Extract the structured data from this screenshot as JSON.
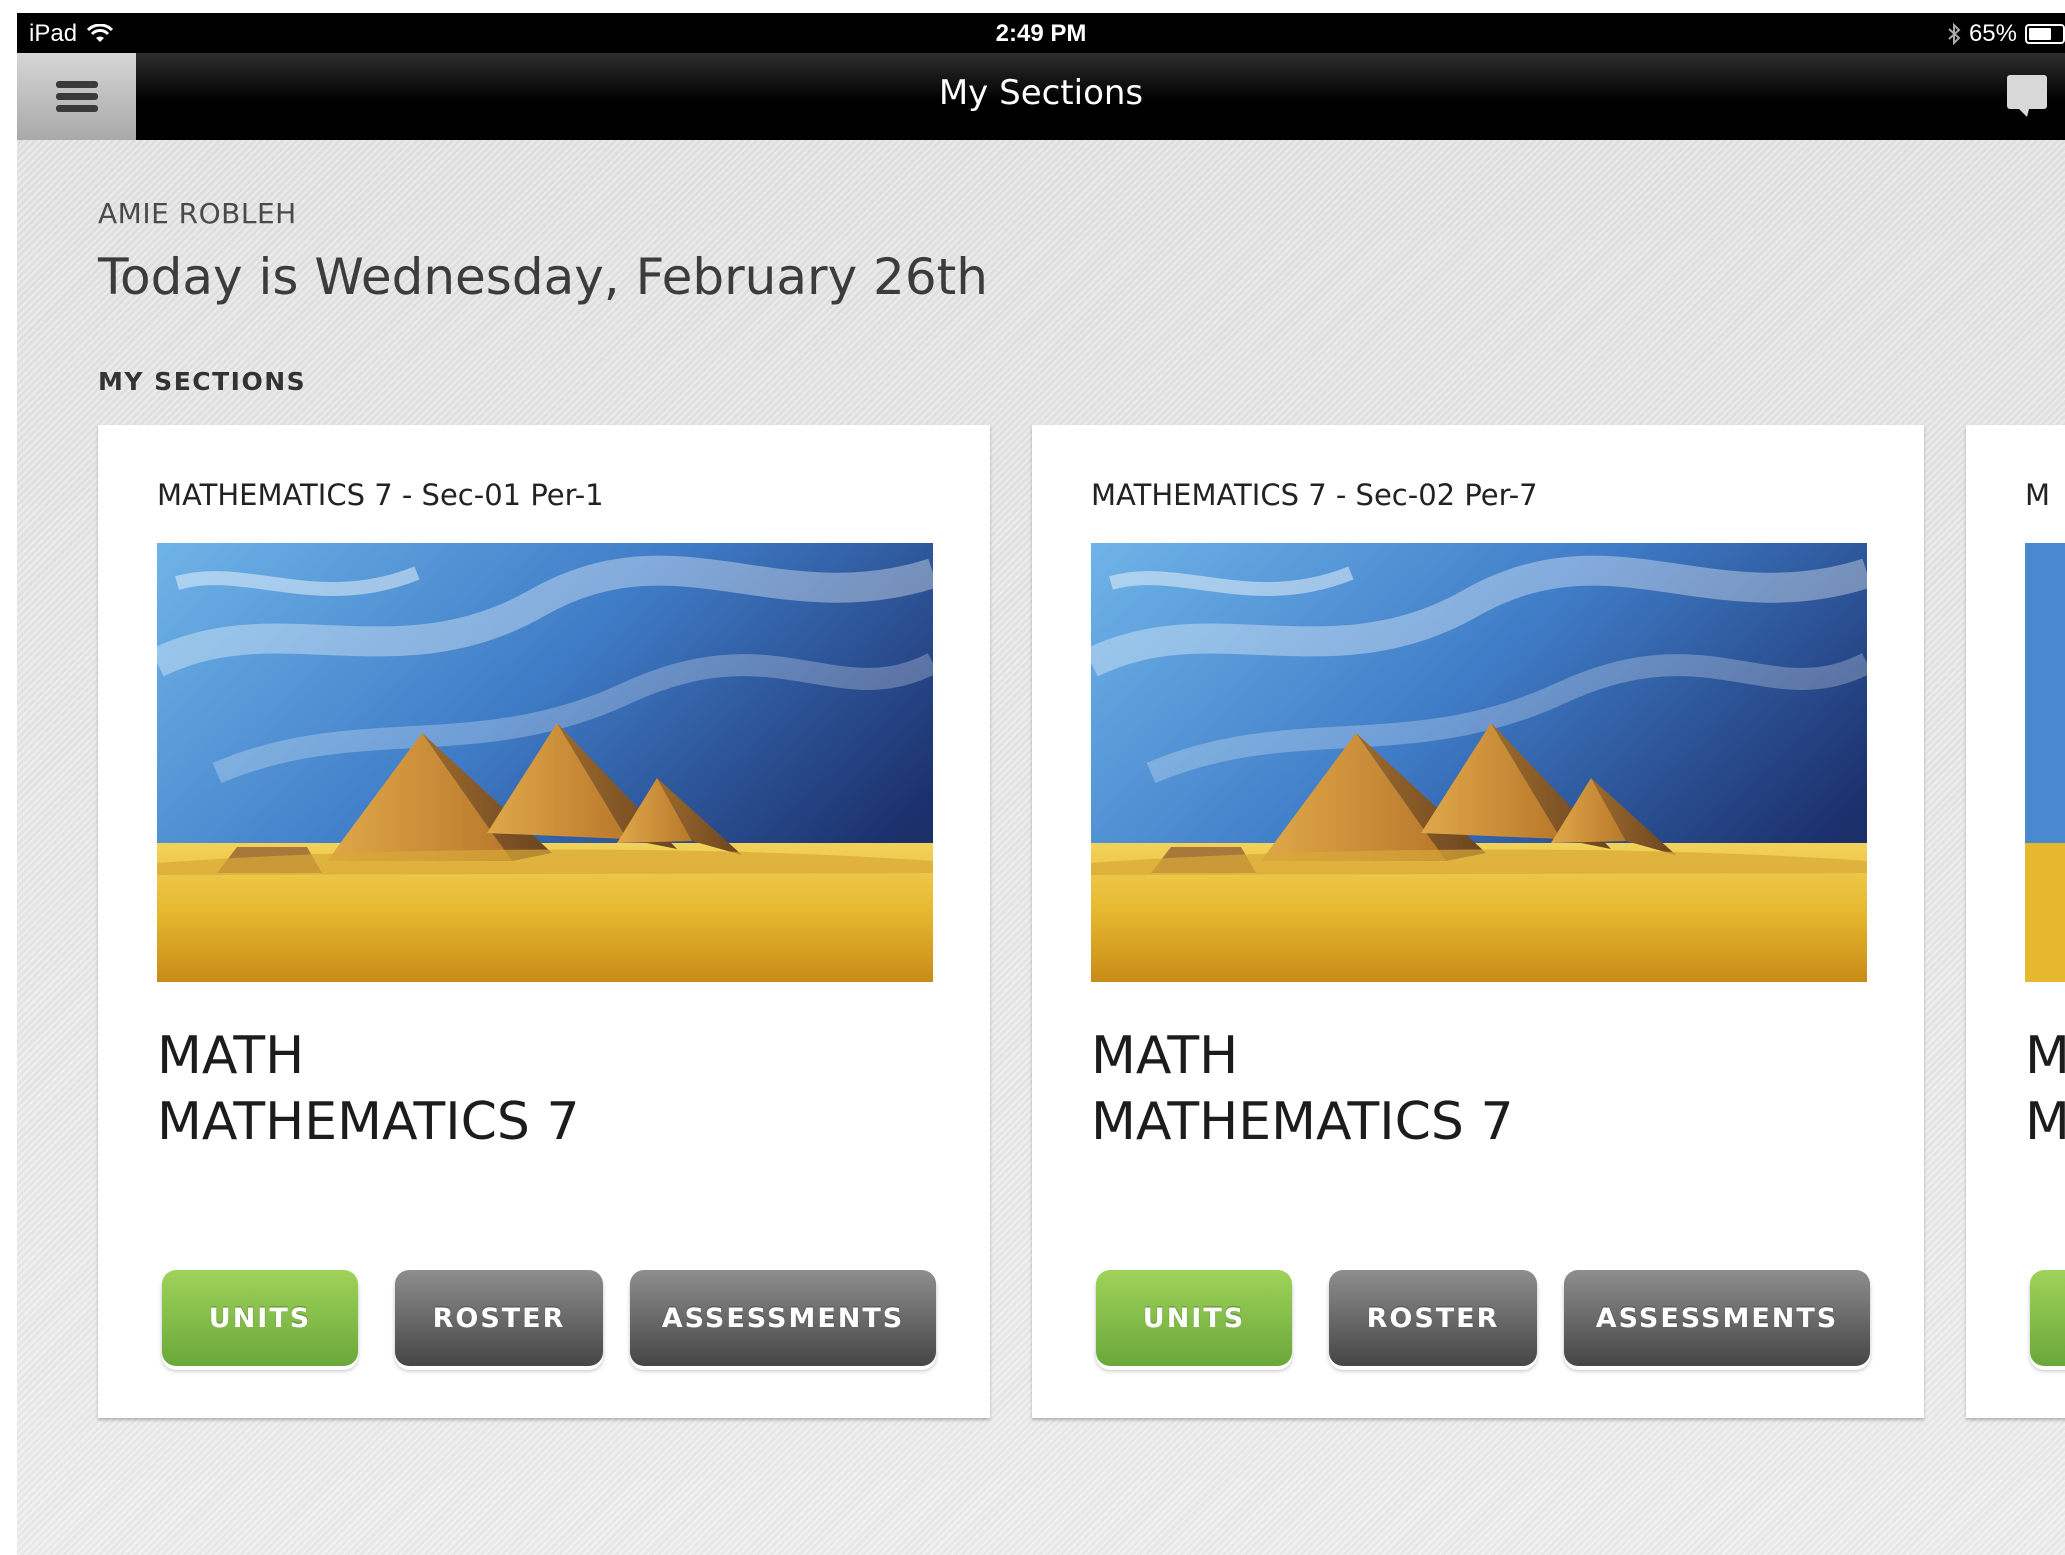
{
  "status_bar": {
    "device": "iPad",
    "time": "2:49 PM",
    "battery": "65%",
    "battery_level": 0.65
  },
  "nav": {
    "title": "My Sections",
    "menu_icon": "hamburger-icon",
    "chat_icon": "chat-bubble-icon"
  },
  "header": {
    "teacher_name": "AMIE ROBLEH",
    "today": "Today is Wednesday, February 26th",
    "sections_label": "MY SECTIONS"
  },
  "sections": [
    {
      "subtitle": "MATHEMATICS 7 - Sec-01 Per-1",
      "title_line1": "MATH",
      "title_line2": "MATHEMATICS 7",
      "units_label": "UNITS",
      "roster_label": "ROSTER",
      "assessments_label": "ASSESSMENTS"
    },
    {
      "subtitle": "MATHEMATICS 7 - Sec-02 Per-7",
      "title_line1": "MATH",
      "title_line2": "MATHEMATICS 7",
      "units_label": "UNITS",
      "roster_label": "ROSTER",
      "assessments_label": "ASSESSMENTS"
    },
    {
      "subtitle": "M",
      "title_line1": "M",
      "title_line2": "M"
    }
  ],
  "colors": {
    "units_button": "#7dbb45",
    "secondary_button": "#5a5a5a",
    "nav_bar": "#000000"
  }
}
